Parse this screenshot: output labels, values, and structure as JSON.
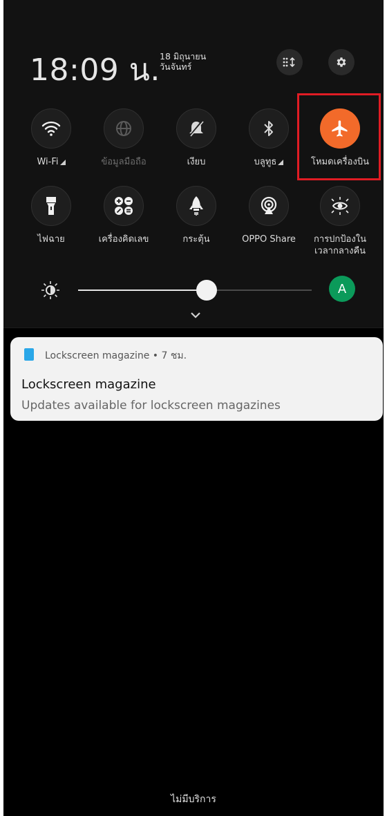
{
  "status": {
    "time": "18:09 น.",
    "date_line1": "18 มิถุนายน",
    "date_line2": "วันจันทร์"
  },
  "header_buttons": [
    {
      "icon": "edit-tiles-icon"
    },
    {
      "icon": "gear-icon"
    }
  ],
  "tiles_row1": [
    {
      "label": "Wi-Fi",
      "icon": "wifi-icon",
      "state": "on"
    },
    {
      "label": "ข้อมูลมือถือ",
      "icon": "globe-icon",
      "state": "disabled"
    },
    {
      "label": "เงียบ",
      "icon": "bell-off-icon",
      "state": "on"
    },
    {
      "label": "บลูทูธ",
      "icon": "bluetooth-icon",
      "state": "on"
    },
    {
      "label": "โหมดเครื่องบิน",
      "icon": "airplane-icon",
      "state": "active"
    }
  ],
  "tiles_row2": [
    {
      "label": "ไฟฉาย",
      "icon": "flashlight-icon"
    },
    {
      "label": "เครื่องคิดเลข",
      "icon": "calculator-icon"
    },
    {
      "label": "กระตุ้น",
      "icon": "rocket-icon"
    },
    {
      "label": "OPPO Share",
      "icon": "share-icon"
    },
    {
      "label_line1": "การปกป้องใน",
      "label_line2": "เวลากลางคืน",
      "icon": "eye-protect-icon"
    }
  ],
  "brightness": {
    "level": 0.55,
    "auto_label": "A"
  },
  "notification": {
    "app_name": "Lockscreen magazine",
    "separator": "•",
    "time": "7 ชม.",
    "title": "Lockscreen magazine",
    "text": "Updates available for lockscreen magazines"
  },
  "footer": {
    "carrier": "ไม่มีบริการ"
  },
  "colors": {
    "accent": "#f26a2a",
    "highlight": "#e01c24",
    "auto": "#0b9a5a"
  }
}
